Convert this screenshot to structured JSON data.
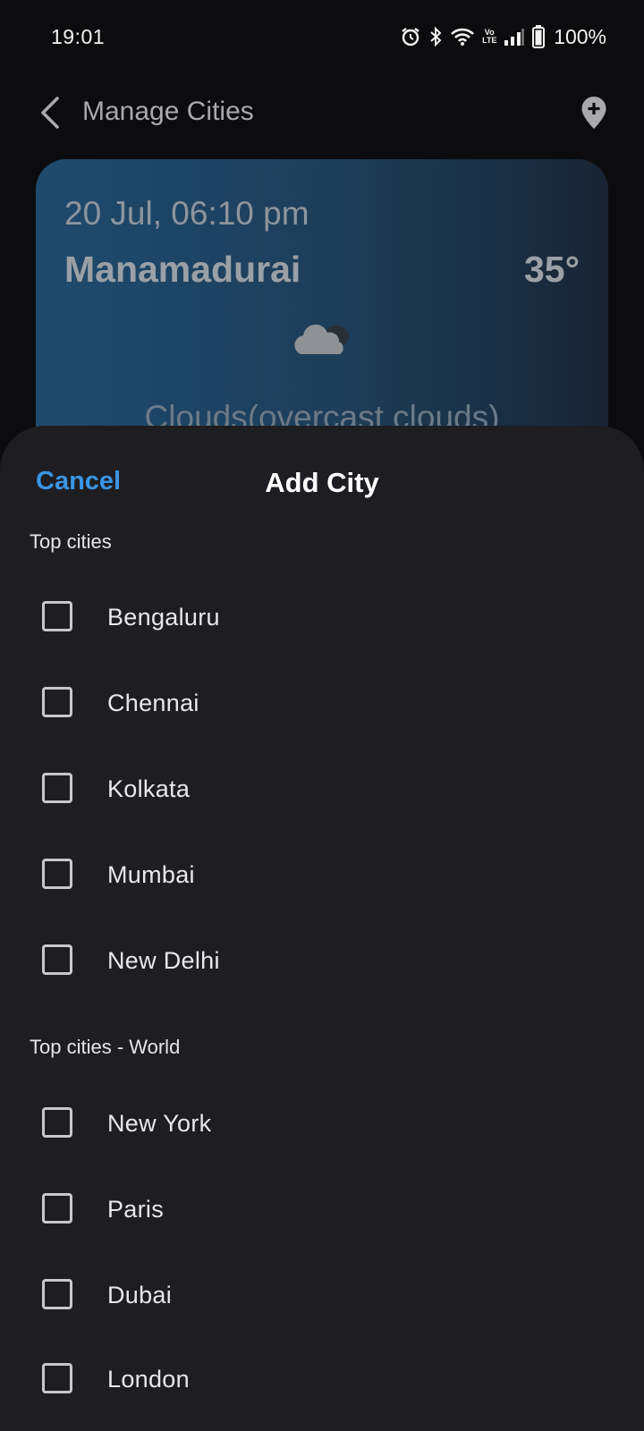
{
  "status_bar": {
    "time": "19:01",
    "battery": "100%",
    "network_label": "Vo\nLTE",
    "icons": [
      "alarm-icon",
      "bluetooth-icon",
      "wifi-icon",
      "volte-icon",
      "signal-icon",
      "battery-icon"
    ]
  },
  "header": {
    "title": "Manage Cities",
    "back_icon": "back-arrow-icon",
    "add_icon": "add-location-icon"
  },
  "weather_card": {
    "datetime": "20 Jul, 06:10 pm",
    "city": "Manamadurai",
    "temperature": "35°",
    "condition": "Clouds(overcast clouds)",
    "icon": "cloud-icon"
  },
  "sheet": {
    "cancel_label": "Cancel",
    "title": "Add City",
    "sections": [
      {
        "title": "Top cities",
        "cities": [
          "Bengaluru",
          "Chennai",
          "Kolkata",
          "Mumbai",
          "New Delhi"
        ]
      },
      {
        "title": "Top cities - World",
        "cities": [
          "New York",
          "Paris",
          "Dubai",
          "London"
        ]
      }
    ]
  },
  "colors": {
    "accent": "#3a95e4",
    "sheet_background": "#1e1d22",
    "page_background": "#0c0c0e"
  }
}
